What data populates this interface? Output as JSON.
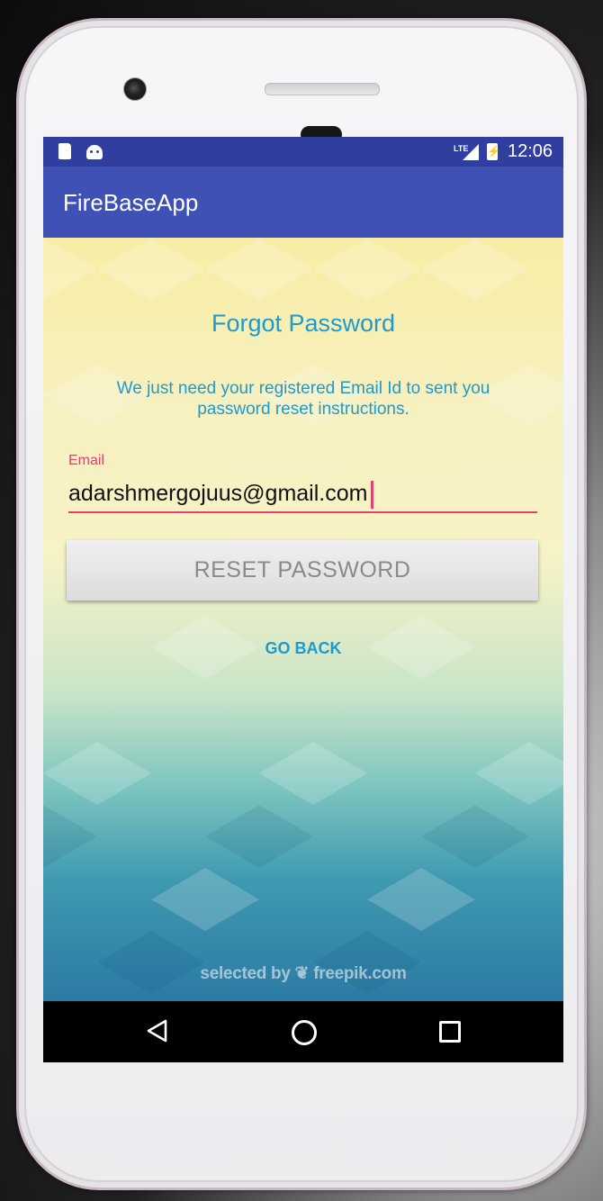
{
  "status_bar": {
    "time": "12:06",
    "network_label": "LTE",
    "icons": [
      "sd-card-icon",
      "android-icon",
      "lte-signal-icon",
      "battery-charging-icon"
    ]
  },
  "app_bar": {
    "title": "FireBaseApp"
  },
  "form": {
    "title": "Forgot Password",
    "subtitle": "We just need your registered Email Id to sent you password reset instructions.",
    "email_label": "Email",
    "email_value": "adarshmergojuus@gmail.com",
    "reset_label": "RESET PASSWORD",
    "go_back_label": "GO BACK"
  },
  "background": {
    "credit": "selected by ❦ freepik.com"
  },
  "nav_bar": {
    "icons": [
      "back-icon",
      "home-icon",
      "recents-icon"
    ]
  },
  "colors": {
    "status_bar": "#303f9f",
    "app_bar": "#3f51b5",
    "accent": "#e5406e",
    "text_blue": "#1e9ad0"
  }
}
